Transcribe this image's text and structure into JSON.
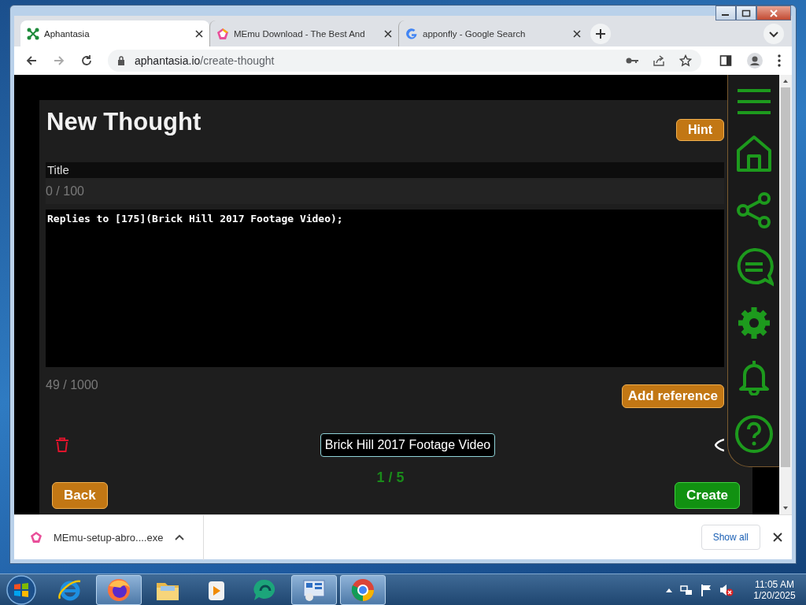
{
  "browser": {
    "tabs": [
      {
        "title": "Aphantasia",
        "kind": "aphantasia",
        "selected": true
      },
      {
        "title": "MEmu Download - The Best And",
        "kind": "memu",
        "selected": false
      },
      {
        "title": "apponfly - Google Search",
        "kind": "google",
        "selected": false
      }
    ],
    "url": {
      "host": "aphantasia.io",
      "path": "/create-thought"
    }
  },
  "page": {
    "heading": "New Thought",
    "hint_button": "Hint",
    "title_label": "Title",
    "title_counter": "0 / 100",
    "body_text": "Replies to [175](Brick Hill 2017 Footage Video);",
    "body_counter": "49 / 1000",
    "add_reference_button": "Add reference",
    "reference_chip": "Brick Hill 2017 Footage Video",
    "pager": "1 / 5",
    "back_button": "Back",
    "create_button": "Create"
  },
  "download_bar": {
    "file": "MEmu-setup-abro....exe",
    "show_all": "Show all"
  },
  "taskbar": {
    "apps": [
      {
        "kind": "ie",
        "open": false
      },
      {
        "kind": "firefox",
        "open": true
      },
      {
        "kind": "folder",
        "open": false
      },
      {
        "kind": "media",
        "open": false
      },
      {
        "kind": "chat",
        "open": false
      },
      {
        "kind": "remote",
        "open": true
      },
      {
        "kind": "chrome",
        "open": true
      }
    ],
    "time": "11:05 AM",
    "date": "1/20/2025"
  }
}
